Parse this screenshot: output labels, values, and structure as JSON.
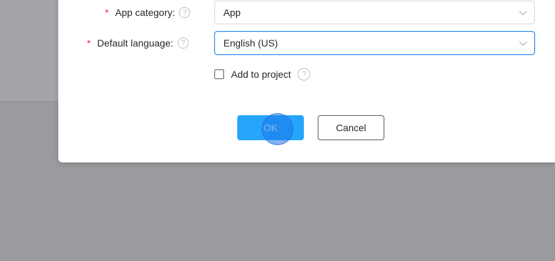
{
  "dialog": {
    "fields": {
      "app_category": {
        "required_mark": "*",
        "label": "App category:",
        "help_icon": "question-circle-icon",
        "value": "App"
      },
      "default_language": {
        "required_mark": "*",
        "label": "Default language:",
        "help_icon": "question-circle-icon",
        "value": "English (US)"
      }
    },
    "add_to_project": {
      "label": "Add to project",
      "checked": false,
      "help_icon": "question-circle-icon"
    },
    "buttons": {
      "ok_label": "OK",
      "cancel_label": "Cancel"
    },
    "help_glyph": "?"
  },
  "colors": {
    "primary": "#27a5fb",
    "required": "#f5222d",
    "focus_border": "#2b8ef0",
    "overlay": "#9a9b9e"
  }
}
